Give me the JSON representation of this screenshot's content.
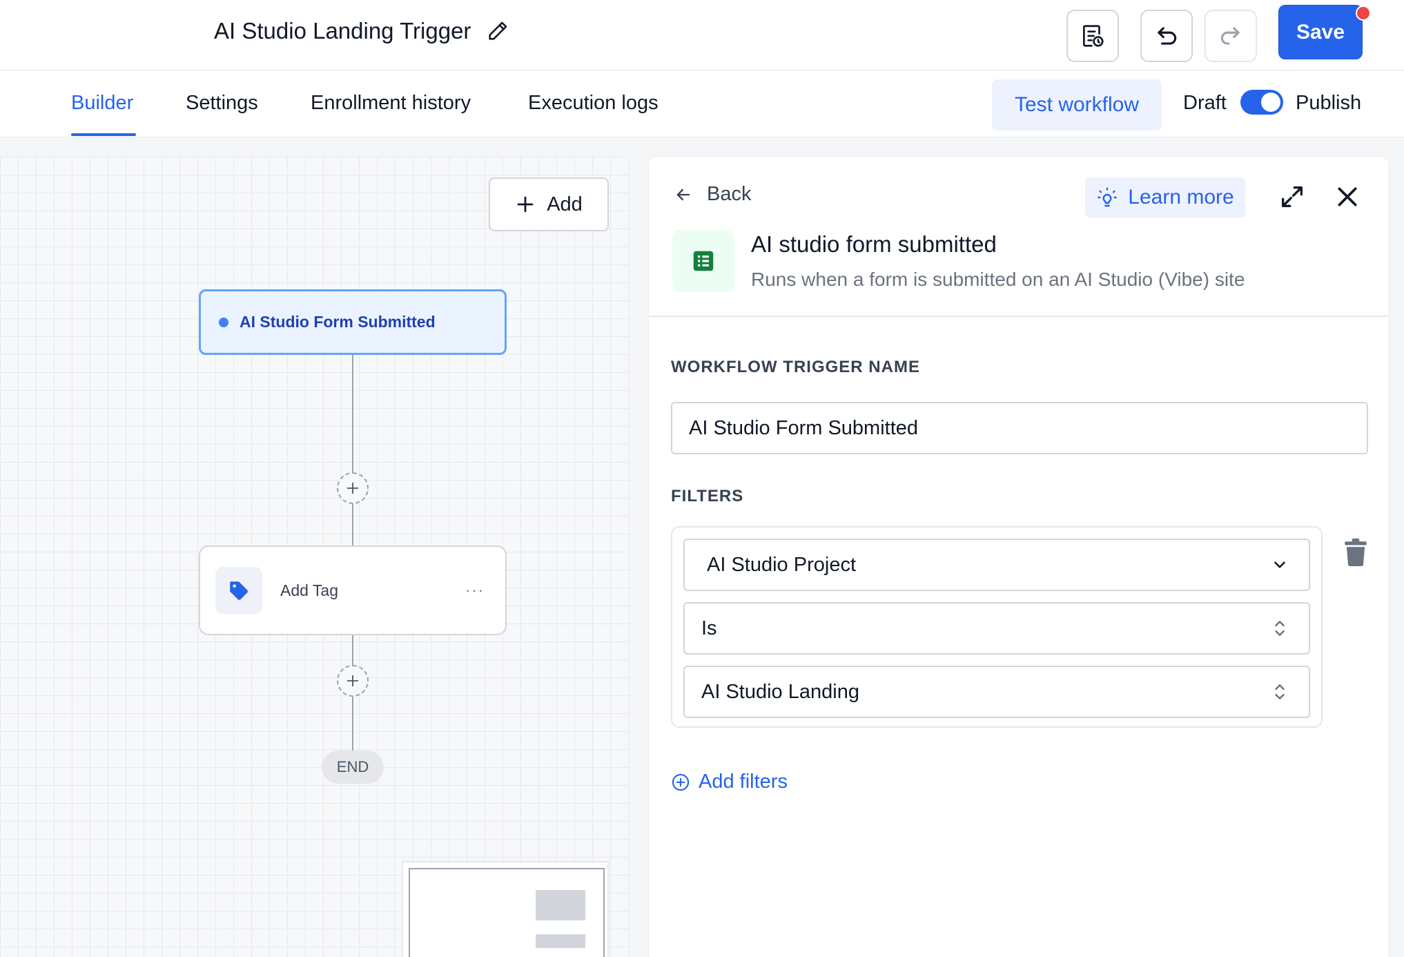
{
  "header": {
    "workflow_title": "AI Studio Landing Trigger",
    "save_label": "Save",
    "icons": [
      "edit-pencil-icon",
      "notes-icon",
      "undo-icon",
      "redo-icon"
    ]
  },
  "tabs": [
    {
      "label": "Builder",
      "active": true
    },
    {
      "label": "Settings",
      "active": false
    },
    {
      "label": "Enrollment history",
      "active": false
    },
    {
      "label": "Execution logs",
      "active": false
    }
  ],
  "toolbar": {
    "test_label": "Test workflow",
    "draft_label": "Draft",
    "publish_label": "Publish",
    "publish_toggle_on": true
  },
  "canvas": {
    "add_label": "Add",
    "trigger_label": "AI Studio Form Submitted",
    "action_label": "Add Tag",
    "action_more": "···",
    "end_label": "END"
  },
  "panel": {
    "back_label": "Back",
    "learn_more_label": "Learn more",
    "title": "AI studio form submitted",
    "subtitle": "Runs when a form is submitted on an AI Studio (Vibe) site",
    "trigger_name_label": "WORKFLOW TRIGGER NAME",
    "trigger_name_value": "AI Studio Form Submitted",
    "filters_label": "FILTERS",
    "filter": {
      "field": "AI Studio Project",
      "operator": "Is",
      "value": "AI Studio Landing"
    },
    "add_filters_label": "Add filters"
  },
  "colors": {
    "accent": "#2563eb",
    "notification_dot": "#ef4444",
    "trigger_bg": "#eaf3ff",
    "sheet_icon_green": "#15803d"
  }
}
